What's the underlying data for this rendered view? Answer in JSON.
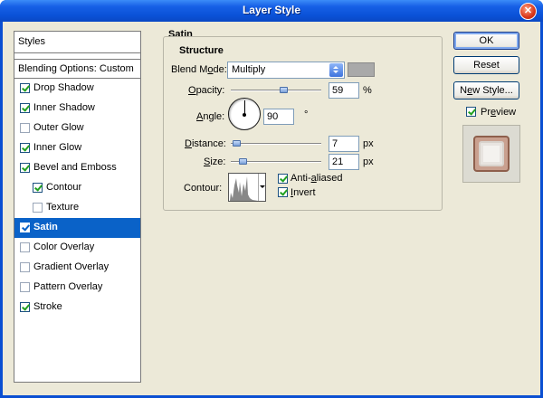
{
  "window": {
    "title": "Layer Style"
  },
  "styles": {
    "header": "Styles",
    "blending": "Blending Options: Custom",
    "items": [
      {
        "label": "Drop Shadow",
        "checked": true,
        "indent": false,
        "selected": false
      },
      {
        "label": "Inner Shadow",
        "checked": true,
        "indent": false,
        "selected": false
      },
      {
        "label": "Outer Glow",
        "checked": false,
        "indent": false,
        "selected": false
      },
      {
        "label": "Inner Glow",
        "checked": true,
        "indent": false,
        "selected": false
      },
      {
        "label": "Bevel and Emboss",
        "checked": true,
        "indent": false,
        "selected": false
      },
      {
        "label": "Contour",
        "checked": true,
        "indent": true,
        "selected": false
      },
      {
        "label": "Texture",
        "checked": false,
        "indent": true,
        "selected": false
      },
      {
        "label": "Satin",
        "checked": true,
        "indent": false,
        "selected": true
      },
      {
        "label": "Color Overlay",
        "checked": false,
        "indent": false,
        "selected": false
      },
      {
        "label": "Gradient Overlay",
        "checked": false,
        "indent": false,
        "selected": false
      },
      {
        "label": "Pattern Overlay",
        "checked": false,
        "indent": false,
        "selected": false
      },
      {
        "label": "Stroke",
        "checked": true,
        "indent": false,
        "selected": false
      }
    ]
  },
  "satin": {
    "section": "Satin",
    "structure": "Structure",
    "blend_mode_label": "Blend Mode:",
    "blend_mode_value": "Multiply",
    "blend_color": "#a9a9a9",
    "opacity_label": "Opacity:",
    "opacity_value": "59",
    "opacity_unit": "%",
    "opacity_fraction": 0.59,
    "angle_label": "Angle:",
    "angle_value": "90",
    "angle_unit": "°",
    "distance_label": "Distance:",
    "distance_value": "7",
    "distance_unit": "px",
    "size_label": "Size:",
    "size_value": "21",
    "size_unit": "px",
    "contour_label": "Contour:",
    "anti_aliased": {
      "label": "Anti-aliased",
      "checked": true
    },
    "invert": {
      "label": "Invert",
      "checked": true
    }
  },
  "buttons": {
    "ok": "OK",
    "reset": "Reset",
    "new_style": "New Style...",
    "preview": {
      "label": "Preview",
      "checked": true
    }
  }
}
